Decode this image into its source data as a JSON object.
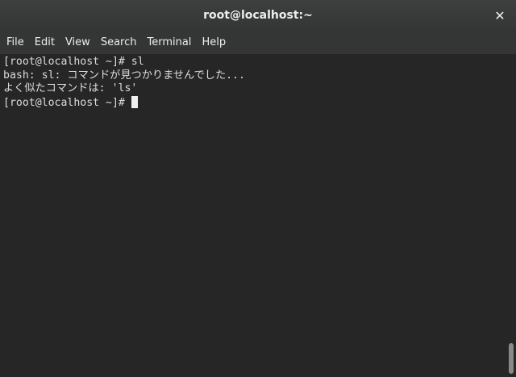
{
  "window": {
    "title": "root@localhost:~",
    "close_symbol": "✕"
  },
  "menubar": {
    "items": [
      "File",
      "Edit",
      "View",
      "Search",
      "Terminal",
      "Help"
    ]
  },
  "terminal": {
    "lines": [
      "[root@localhost ~]# sl",
      "bash: sl: コマンドが見つかりませんでした...",
      "よく似たコマンドは: 'ls'",
      "[root@localhost ~]#"
    ]
  }
}
